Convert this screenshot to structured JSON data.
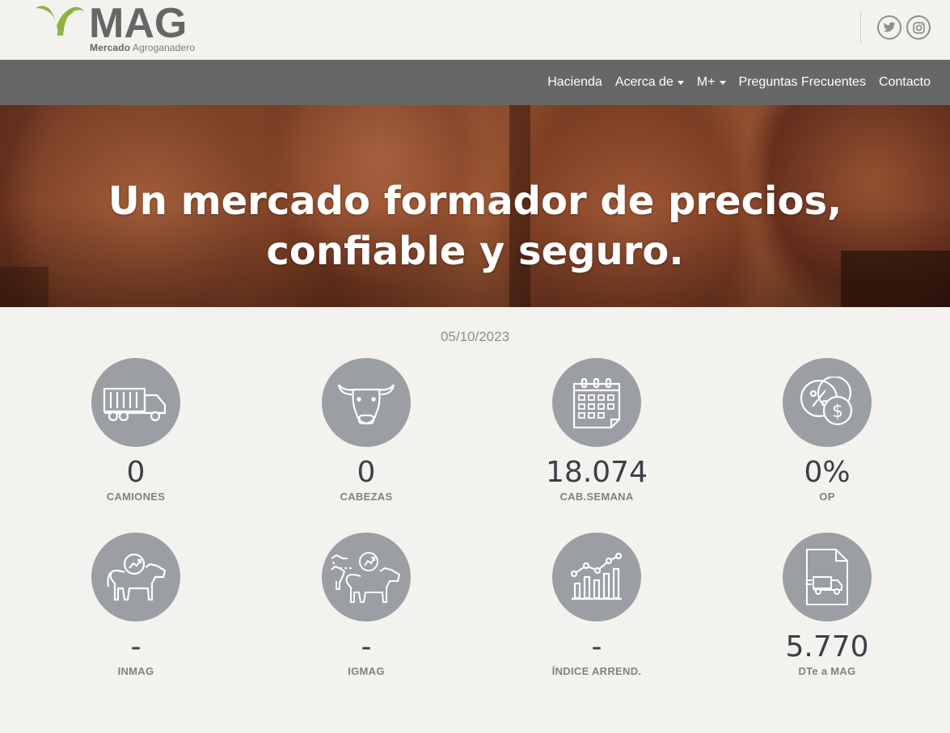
{
  "brand": {
    "logo_text": "MAG",
    "sub_bold": "Mercado",
    "sub_rest": " Agroganadero",
    "accent": "#8db43c"
  },
  "social": {
    "twitter_icon": "twitter-icon",
    "instagram_icon": "instagram-icon"
  },
  "nav": {
    "items": [
      {
        "label": "Hacienda",
        "dropdown": false
      },
      {
        "label": "Acerca de",
        "dropdown": true
      },
      {
        "label": "M+",
        "dropdown": true
      },
      {
        "label": "Preguntas Frecuentes",
        "dropdown": false
      },
      {
        "label": "Contacto",
        "dropdown": false
      }
    ]
  },
  "hero": {
    "title": "Un mercado formador de precios, confiable y seguro."
  },
  "stats": {
    "date": "05/10/2023",
    "items": [
      {
        "value": "0",
        "label": "CAMIONES",
        "icon": "truck-icon"
      },
      {
        "value": "0",
        "label": "CABEZAS",
        "icon": "cow-head-icon"
      },
      {
        "value": "18.074",
        "label": "CAB.SEMANA",
        "icon": "calendar-icon"
      },
      {
        "value": "0%",
        "label": "OP",
        "icon": "percent-dollar-icon"
      },
      {
        "value": "-",
        "label": "INMAG",
        "icon": "cow-trend-icon"
      },
      {
        "value": "-",
        "label": "IGMAG",
        "icon": "cows-trend-icon"
      },
      {
        "value": "-",
        "label": "ÍNDICE ARREND.",
        "icon": "bar-chart-icon"
      },
      {
        "value": "5.770",
        "label": "DTe a MAG",
        "icon": "document-truck-icon"
      }
    ]
  }
}
